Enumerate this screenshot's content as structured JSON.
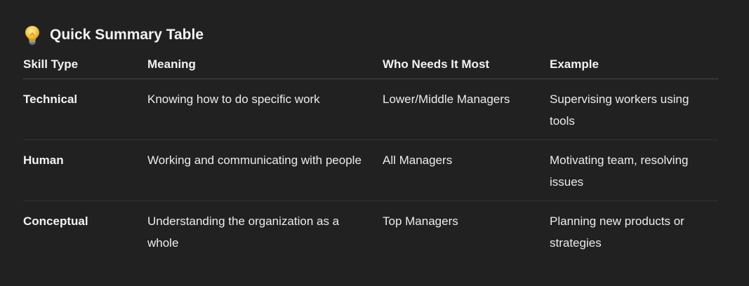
{
  "heading": {
    "icon": "lightbulb-icon",
    "title": "Quick Summary Table"
  },
  "table": {
    "headers": [
      "Skill Type",
      "Meaning",
      "Who Needs It Most",
      "Example"
    ],
    "rows": [
      [
        "Technical",
        "Knowing how to do specific work",
        "Lower/Middle Managers",
        "Supervising workers using tools"
      ],
      [
        "Human",
        "Working and communicating with people",
        "All Managers",
        "Motivating team, resolving issues"
      ],
      [
        "Conceptual",
        "Understanding the organization as a whole",
        "Top Managers",
        "Planning new products or strategies"
      ]
    ]
  },
  "colors": {
    "background": "#212121",
    "text": "#ececec",
    "divider": "#333333",
    "bulb": "#f7c843"
  }
}
